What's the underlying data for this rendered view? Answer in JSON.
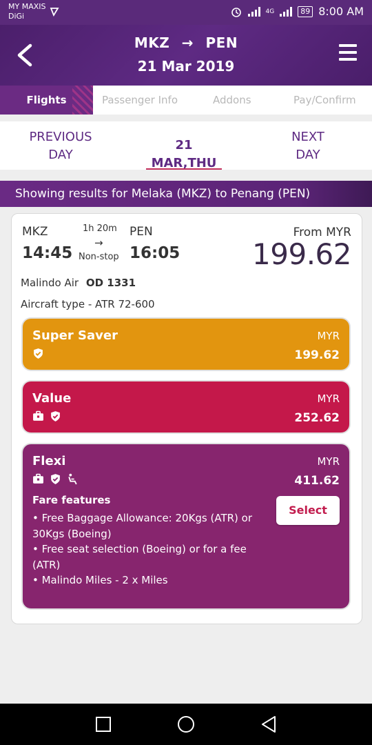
{
  "status_bar": {
    "carrier_1": "MY MAXIS",
    "carrier_2": "DiGi",
    "network": "4G",
    "battery": "89",
    "time": "8:00 AM"
  },
  "header": {
    "origin": "MKZ",
    "destination": "PEN",
    "arrow": "→",
    "date": "21 Mar 2019"
  },
  "steps": [
    "Flights",
    "Passenger Info",
    "Addons",
    "Pay/Confirm"
  ],
  "day_nav": {
    "previous_line1": "PREVIOUS",
    "previous_line2": "DAY",
    "current": "21 MAR,THU",
    "next_line1": "NEXT",
    "next_line2": "DAY"
  },
  "results_text": "Showing results for Melaka (MKZ) to Penang (PEN)",
  "flight": {
    "dep_code": "MKZ",
    "dep_time": "14:45",
    "duration": "1h 20m",
    "arrow": "→",
    "stops": "Non-stop",
    "arr_code": "PEN",
    "arr_time": "16:05",
    "from_label": "From MYR",
    "from_price": "199.62",
    "airline": "Malindo Air",
    "flight_no": "OD 1331",
    "aircraft": "Aircraft type - ATR 72-600"
  },
  "fares": [
    {
      "name": "Super Saver",
      "currency": "MYR",
      "price": "199.62",
      "color": "#e2950f",
      "icons": [
        "shield-icon"
      ]
    },
    {
      "name": "Value",
      "currency": "MYR",
      "price": "252.62",
      "color": "#c4184a",
      "icons": [
        "baggage-icon",
        "shield-icon"
      ]
    },
    {
      "name": "Flexi",
      "currency": "MYR",
      "price": "411.62",
      "color": "#87256e",
      "icons": [
        "baggage-icon",
        "shield-icon",
        "seat-icon"
      ]
    }
  ],
  "flexi_features": {
    "title": "Fare features",
    "items": [
      "• Free Baggage Allowance: 20Kgs (ATR) or 30Kgs (Boeing)",
      "• Free seat selection (Boeing) or for a fee (ATR)",
      "• Malindo Miles - 2 x Miles"
    ],
    "select_label": "Select"
  },
  "nav_icons": [
    "recent-apps-icon",
    "home-icon",
    "back-icon"
  ]
}
